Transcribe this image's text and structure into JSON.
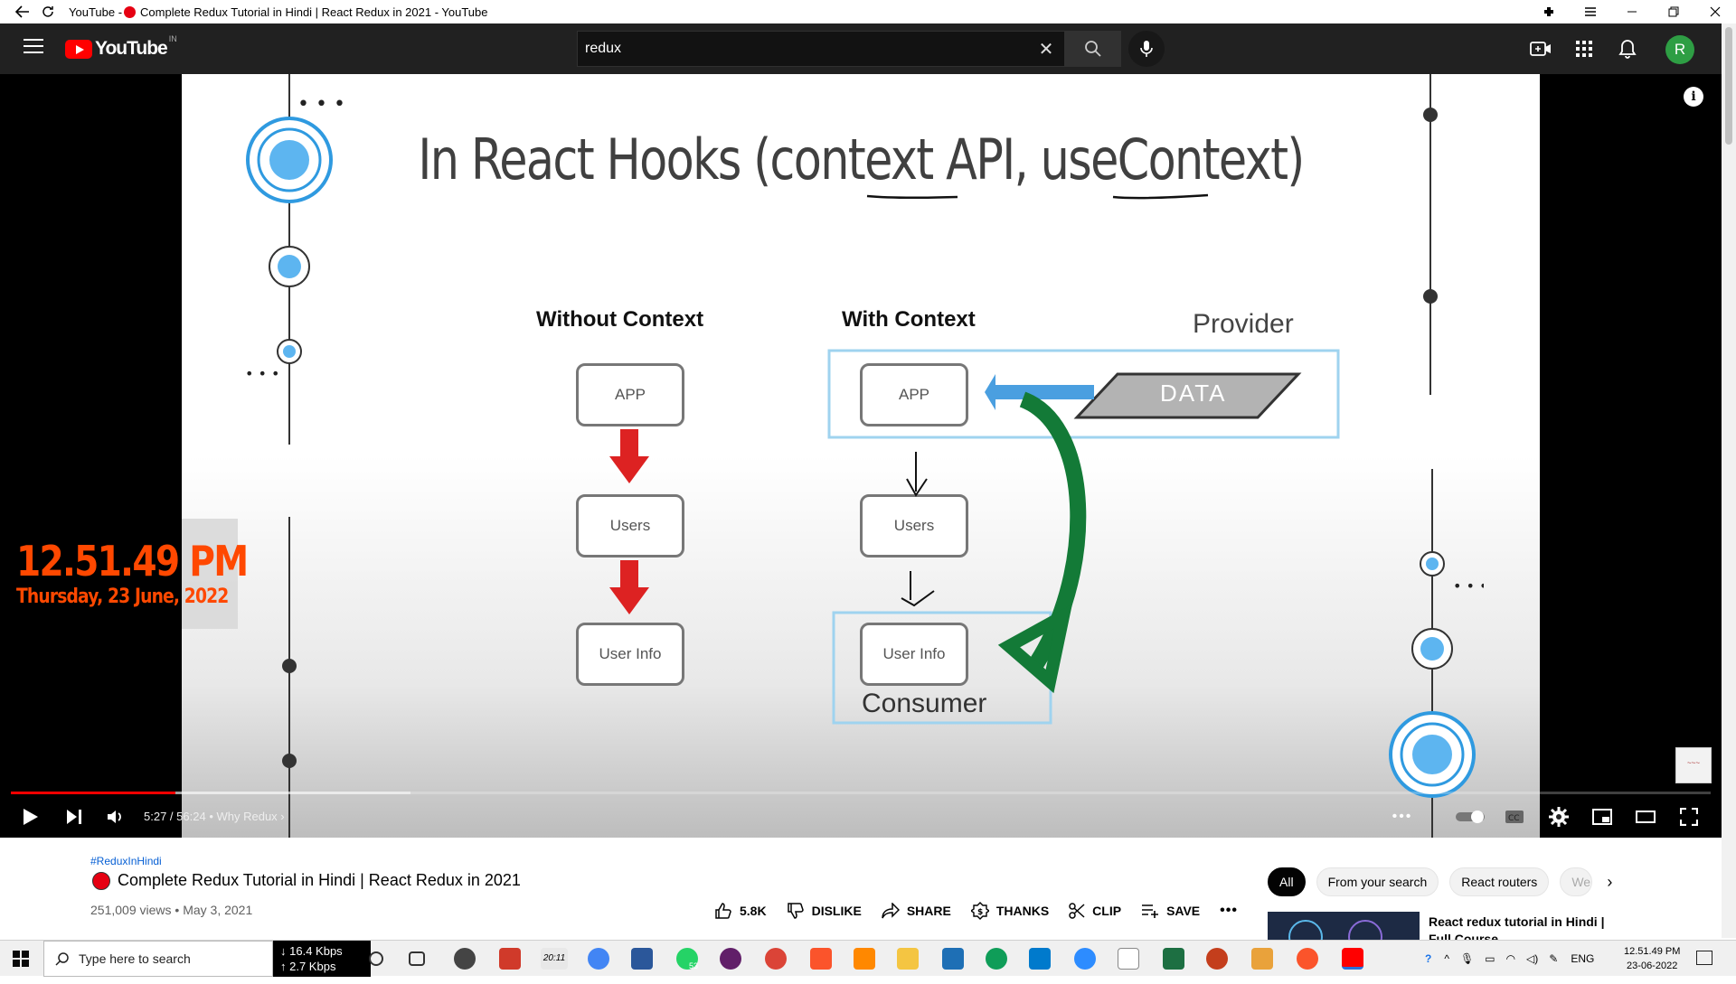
{
  "browser": {
    "title_prefix": "YouTube - ",
    "title": "Complete Redux Tutorial in Hindi | React Redux in 2021 - YouTube"
  },
  "header": {
    "logo_text": "YouTube",
    "country_code": "IN",
    "search_value": "redux",
    "avatar_letter": "R"
  },
  "player": {
    "slide": {
      "title": "In React Hooks (context API, useContext)",
      "without_context": {
        "heading": "Without Context",
        "boxes": [
          "APP",
          "Users",
          "User Info"
        ]
      },
      "with_context": {
        "heading": "With Context",
        "boxes": [
          "APP",
          "Users",
          "User Info"
        ],
        "provider_label": "Provider",
        "data_label": "DATA",
        "consumer_label": "Consumer"
      }
    },
    "overlay_clock": {
      "time": "12.51.49 PM",
      "date": "Thursday, 23 June, 2022"
    },
    "current_time": "5:27",
    "duration": "56:24",
    "chapter": "Why Redux",
    "progress_played": 0.097,
    "progress_loaded": 0.235,
    "colors": {
      "progress": "#ff0000",
      "clock": "#ff4800"
    }
  },
  "video": {
    "hashtag": "#ReduxInHindi",
    "title": "Complete Redux Tutorial in Hindi | React Redux in 2021",
    "views": "251,009 views",
    "date": "May 3, 2021",
    "actions": {
      "like": "5.8K",
      "dislike": "DISLIKE",
      "share": "SHARE",
      "thanks": "THANKS",
      "clip": "CLIP",
      "save": "SAVE"
    }
  },
  "sidebar": {
    "chips": [
      "All",
      "From your search",
      "React routers",
      "We"
    ],
    "recommendation_title": "React redux tutorial in Hindi | Full Course"
  },
  "taskbar": {
    "search_placeholder": "Type here to search",
    "download_speed": "16.4 Kbps",
    "upload_speed": "2.7 Kbps",
    "language": "ENG",
    "time": "12.51.49 PM",
    "date": "23-06-2022",
    "whatsapp_badge": "53",
    "widget_time": "20:11"
  }
}
